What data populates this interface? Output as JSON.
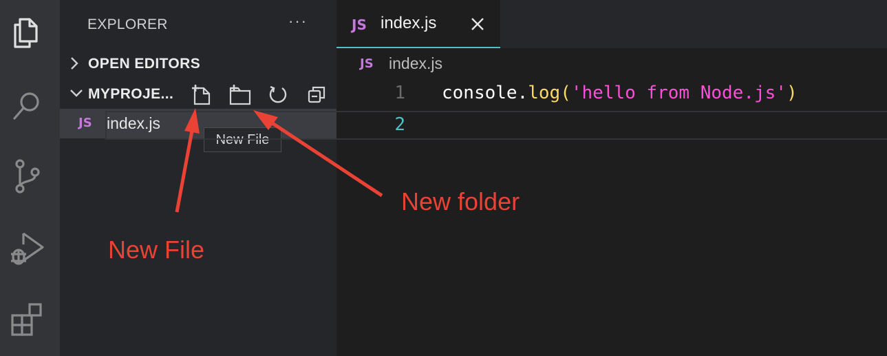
{
  "activity_bar": {
    "icons": [
      "explorer-icon",
      "search-icon",
      "source-control-icon",
      "run-debug-icon",
      "extensions-icon"
    ]
  },
  "sidebar": {
    "title": "EXPLORER",
    "more_label": "···",
    "open_editors_label": "OPEN EDITORS",
    "project_label": "MYPROJE...",
    "toolbar_icons": [
      "new-file-icon",
      "new-folder-icon",
      "refresh-icon",
      "collapse-all-icon"
    ],
    "files": [
      {
        "badge": "JS",
        "name": "index.js"
      }
    ],
    "tooltip": "New File"
  },
  "tabs": [
    {
      "badge": "JS",
      "label": "index.js",
      "close_icon": "close-icon",
      "active": true
    }
  ],
  "breadcrumb": {
    "badge": "JS",
    "label": "index.js"
  },
  "editor": {
    "lines": [
      {
        "number": "1",
        "tokens": {
          "obj": "console.",
          "fn": "log",
          "open": "(",
          "str": "'hello from Node.js'",
          "close": ")"
        }
      },
      {
        "number": "2"
      }
    ]
  },
  "annotations": {
    "new_file": "New File",
    "new_folder": "New folder",
    "color": "#ea4335"
  },
  "colors": {
    "accent": "#4fc1c9",
    "js_badge": "#c678dd",
    "function": "#ffd866",
    "string": "#ff4fd8"
  }
}
